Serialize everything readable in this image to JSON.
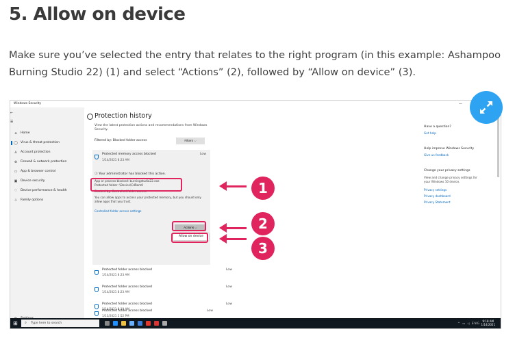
{
  "article": {
    "heading": "5. Allow on device",
    "paragraph": "Make sure you’ve selected the entry that relates to the right program (in this example: Ashampoo Burning Studio 22) (1) and select “Actions” (2), followed by “Allow on device” (3)."
  },
  "screenshot": {
    "window_title": "Windows Security",
    "nav": {
      "back": "←",
      "menu": "☰",
      "items": [
        {
          "icon": "home-icon",
          "glyph": "⌂",
          "label": "Home"
        },
        {
          "icon": "shield-icon",
          "glyph": "◯",
          "label": "Virus & threat protection"
        },
        {
          "icon": "person-icon",
          "glyph": "♙",
          "label": "Account protection"
        },
        {
          "icon": "wifi-icon",
          "glyph": "⊚",
          "label": "Firewall & network protection"
        },
        {
          "icon": "browser-icon",
          "glyph": "▭",
          "label": "App & browser control"
        },
        {
          "icon": "device-icon",
          "glyph": "▣",
          "label": "Device security"
        },
        {
          "icon": "heart-icon",
          "glyph": "♡",
          "label": "Device performance & health"
        },
        {
          "icon": "family-icon",
          "glyph": "♧",
          "label": "Family options"
        }
      ],
      "settings": {
        "icon": "gear-icon",
        "glyph": "⚙",
        "label": "Settings"
      }
    },
    "protection_history": {
      "title": "Protection history",
      "description": "View the latest protection actions and recommendations from Windows Security.",
      "filtered_by": "Filtered by: Blocked folder access",
      "filters_label": "Filters ⌵",
      "selected_entry": {
        "title": "Protected memory access blocked",
        "date": "1/14/2021 8:23 AM",
        "severity": "Low",
        "admin_message": "Your administrator has blocked this action.",
        "app_line": "App or process blocked: burningstudio22.exe",
        "folder_line": "Protected folder: \\Device\\CdRom0",
        "blocked_by": "Blocked by: Controlled folder access",
        "allow_text": "You can allow apps to access your protected memory, but you should only allow apps that you trust.",
        "settings_link": "Controlled folder access settings",
        "actions_label": "Actions ⌵",
        "allow_on_device": "Allow on device"
      },
      "entries": [
        {
          "title": "Protected folder access blocked",
          "date": "1/14/2021 8:23 AM",
          "severity": "Low"
        },
        {
          "title": "Protected folder access blocked",
          "date": "1/14/2021 8:23 AM",
          "severity": "Low"
        },
        {
          "title": "Protected folder access blocked",
          "date": "1/14/2021 8:19 AM",
          "severity": "Low"
        },
        {
          "title": "Protected folder access blocked",
          "date": "1/14/2021 8:16 AM",
          "severity": "Low"
        },
        {
          "title": "Protected folder access blocked",
          "date": "1/13/2021 2:52 PM",
          "severity": "Low"
        }
      ]
    },
    "right_panel": {
      "question_heading": "Have a question?",
      "get_help": "Get help",
      "improve_heading": "Help improve Windows Security",
      "feedback": "Give us feedback",
      "privacy_heading": "Change your privacy settings",
      "privacy_text": "View and change privacy settings for your Windows 10 device.",
      "privacy_settings": "Privacy settings",
      "privacy_dashboard": "Privacy dashboard",
      "privacy_statement": "Privacy Statement"
    },
    "taskbar": {
      "search_placeholder": "Type here to search",
      "time": "9:18 AM",
      "date": "1/14/2021"
    }
  },
  "callouts": {
    "one": "1",
    "two": "2",
    "three": "3",
    "color": "#e0245e"
  },
  "colors": {
    "accent": "#0067c0",
    "expand_button": "#2ea3f2"
  }
}
